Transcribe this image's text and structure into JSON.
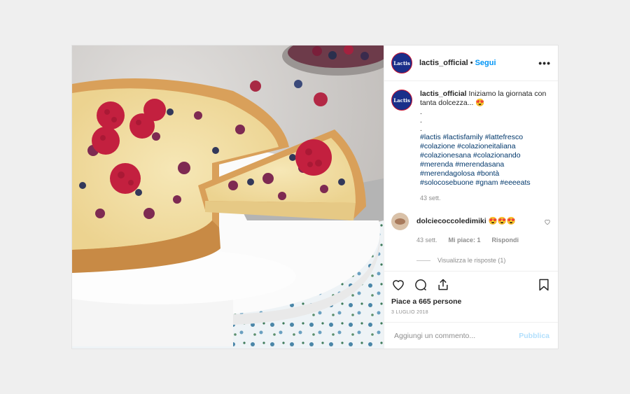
{
  "post": {
    "username": "lactis_official",
    "separator": "•",
    "follow_label": "Segui",
    "more_label": "•••",
    "avatar_text": "Lactis"
  },
  "caption": {
    "username": "lactis_official",
    "text": "Iniziamo la giornata con tanta dolcezza... 😍",
    "dots": [
      ".",
      ".",
      "."
    ],
    "hashtags": "#lactis #lactisfamily #lattefresco #colazione #colazioneitaliana #colazionesana #colazionando #merenda #merendasana #merendagolosa #bontà #solocosebuone #gnam #eeeeats",
    "time": "43 sett."
  },
  "reply": {
    "username": "dolciecoccoledimiki",
    "text": "😍😍😍",
    "time": "43 sett.",
    "likes": "Mi piace: 1",
    "reply_label": "Rispondi",
    "view_replies": "Visualizza le risposte (1)"
  },
  "likes_text": "Piace a 665 persone",
  "date_text": "3 LUGLIO 2018",
  "comment_box": {
    "placeholder": "Aggiungi un commento...",
    "publish_label": "Pubblica"
  },
  "icons": [
    "heart-icon",
    "comment-icon",
    "share-icon",
    "bookmark-icon"
  ]
}
